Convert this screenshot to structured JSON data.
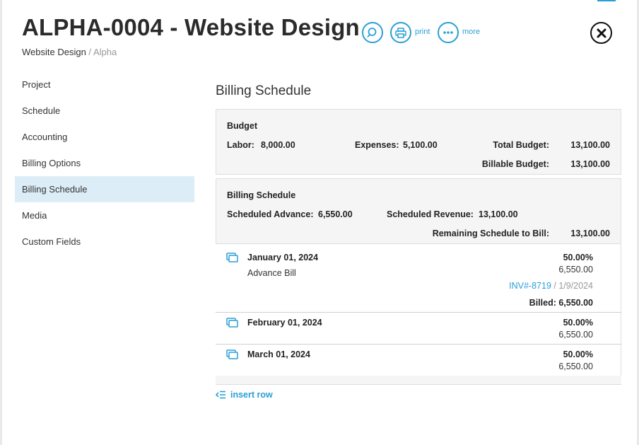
{
  "header": {
    "title": "ALPHA-0004 - Website Design",
    "breadcrumb": {
      "current": "Website Design",
      "separator": " / ",
      "parent": "Alpha"
    },
    "actions": {
      "print_label": "print",
      "more_label": "more"
    }
  },
  "nav": {
    "items": [
      {
        "label": "Project"
      },
      {
        "label": "Schedule"
      },
      {
        "label": "Accounting"
      },
      {
        "label": "Billing Options"
      },
      {
        "label": "Billing Schedule",
        "active": true
      },
      {
        "label": "Media"
      },
      {
        "label": "Custom Fields"
      }
    ]
  },
  "main": {
    "title": "Billing Schedule",
    "budget": {
      "heading": "Budget",
      "labor_label": "Labor:",
      "labor_value": "8,000.00",
      "expenses_label": "Expenses:",
      "expenses_value": "5,100.00",
      "total_label": "Total Budget:",
      "total_value": "13,100.00",
      "billable_label": "Billable Budget:",
      "billable_value": "13,100.00"
    },
    "billing_schedule": {
      "heading": "Billing Schedule",
      "advance_label": "Scheduled Advance:",
      "advance_value": "6,550.00",
      "revenue_label": "Scheduled Revenue:",
      "revenue_value": "13,100.00",
      "remaining_label": "Remaining Schedule to Bill:",
      "remaining_value": "13,100.00"
    },
    "rows": [
      {
        "date": "January 01, 2024",
        "description": "Advance Bill",
        "percent": "50.00%",
        "amount": "6,550.00",
        "invoice": "INV#-8719",
        "invoice_sep": " / ",
        "invoice_date": "1/9/2024",
        "billed": "Billed: 6,550.00"
      },
      {
        "date": "February 01, 2024",
        "percent": "50.00%",
        "amount": "6,550.00"
      },
      {
        "date": "March 01, 2024",
        "percent": "50.00%",
        "amount": "6,550.00"
      }
    ],
    "insert_row_label": "insert row"
  },
  "colors": {
    "accent": "#2a9fd6",
    "active_nav": "#dcedf8",
    "panel": "#f5f5f5"
  },
  "icons": [
    "search-icon",
    "print-icon",
    "more-icon",
    "close-icon",
    "copy-icon",
    "insert-row-icon"
  ]
}
